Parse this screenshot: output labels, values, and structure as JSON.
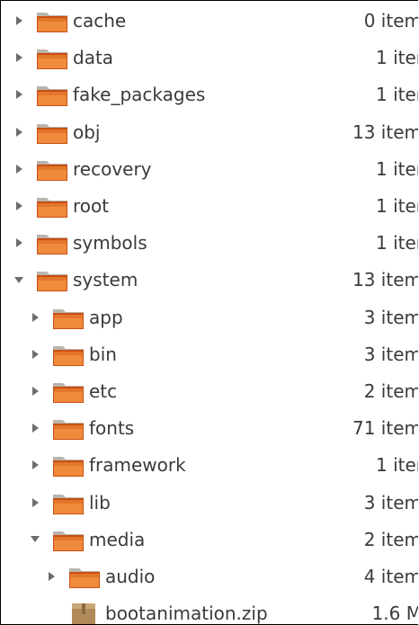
{
  "tree": {
    "rows": [
      {
        "name": "cache",
        "size": "0 item",
        "level": 0,
        "type": "folder",
        "expanded": false
      },
      {
        "name": "data",
        "size": "1 iter",
        "level": 0,
        "type": "folder",
        "expanded": false
      },
      {
        "name": "fake_packages",
        "size": "1 iter",
        "level": 0,
        "type": "folder",
        "expanded": false
      },
      {
        "name": "obj",
        "size": "13 item",
        "level": 0,
        "type": "folder",
        "expanded": false
      },
      {
        "name": "recovery",
        "size": "1 iter",
        "level": 0,
        "type": "folder",
        "expanded": false
      },
      {
        "name": "root",
        "size": "1 iter",
        "level": 0,
        "type": "folder",
        "expanded": false
      },
      {
        "name": "symbols",
        "size": "1 iter",
        "level": 0,
        "type": "folder",
        "expanded": false
      },
      {
        "name": "system",
        "size": "13 item",
        "level": 0,
        "type": "folder",
        "expanded": true
      },
      {
        "name": "app",
        "size": "3 item",
        "level": 1,
        "type": "folder",
        "expanded": false
      },
      {
        "name": "bin",
        "size": "3 item",
        "level": 1,
        "type": "folder",
        "expanded": false
      },
      {
        "name": "etc",
        "size": "2 item",
        "level": 1,
        "type": "folder",
        "expanded": false
      },
      {
        "name": "fonts",
        "size": "71 item",
        "level": 1,
        "type": "folder",
        "expanded": false
      },
      {
        "name": "framework",
        "size": "1 iter",
        "level": 1,
        "type": "folder",
        "expanded": false
      },
      {
        "name": "lib",
        "size": "3 item",
        "level": 1,
        "type": "folder",
        "expanded": false
      },
      {
        "name": "media",
        "size": "2 item",
        "level": 1,
        "type": "folder",
        "expanded": true
      },
      {
        "name": "audio",
        "size": "4 item",
        "level": 2,
        "type": "folder",
        "expanded": false
      },
      {
        "name": "bootanimation.zip",
        "size": "1.6 M",
        "level": 2,
        "type": "file",
        "expanded": false
      }
    ]
  },
  "colors": {
    "folder_dark": "#c94f12",
    "folder_light": "#f08a3c",
    "folder_tab": "#b9b4ad",
    "zip_icon": "#b08a5a",
    "text": "#3a3a3a"
  }
}
